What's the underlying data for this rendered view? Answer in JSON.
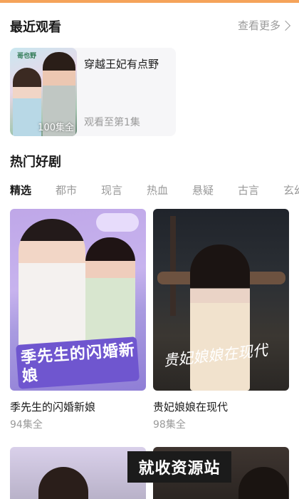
{
  "recent": {
    "title": "最近观看",
    "see_more": "查看更多",
    "item": {
      "poster_logo": "哥也野",
      "episode_count": "100集全",
      "title": "穿越王妃有点野",
      "progress": "观看至第1集"
    }
  },
  "hot": {
    "title": "热门好剧",
    "tabs": [
      "精选",
      "都市",
      "现言",
      "热血",
      "悬疑",
      "古言",
      "玄幻"
    ],
    "items": [
      {
        "poster_text": "季先生的闪婚新娘",
        "title": "季先生的闪婚新娘",
        "count": "94集全"
      },
      {
        "poster_text": "贵妃娘娘在现代",
        "title": "贵妃娘娘在现代",
        "count": "98集全"
      }
    ]
  },
  "watermark": "就收资源站",
  "colors": {
    "accent_topbar": "#f5a35a",
    "muted_text": "#9a9a9a",
    "card_bg": "#f6f6f8"
  }
}
